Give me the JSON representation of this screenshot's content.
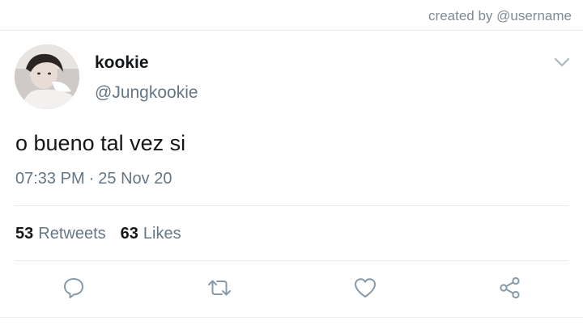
{
  "header": {
    "credit": "created by @username"
  },
  "user": {
    "name": "kookie",
    "handle": "@Jungkookie",
    "avatar_icon": "profile-photo"
  },
  "tweet": {
    "text": "o bueno tal vez si",
    "time": "07:33 PM",
    "separator": "·",
    "date": "25 Nov 20"
  },
  "stats": {
    "retweets_count": "53",
    "retweets_label": "Retweets",
    "likes_count": "63",
    "likes_label": "Likes"
  },
  "actions": {
    "reply_icon": "reply-icon",
    "retweet_icon": "retweet-icon",
    "like_icon": "heart-icon",
    "share_icon": "share-icon"
  },
  "colors": {
    "primary_text": "#14171a",
    "secondary_text": "#657786",
    "icon": "#8899a6",
    "divider": "#e6ecf0"
  }
}
